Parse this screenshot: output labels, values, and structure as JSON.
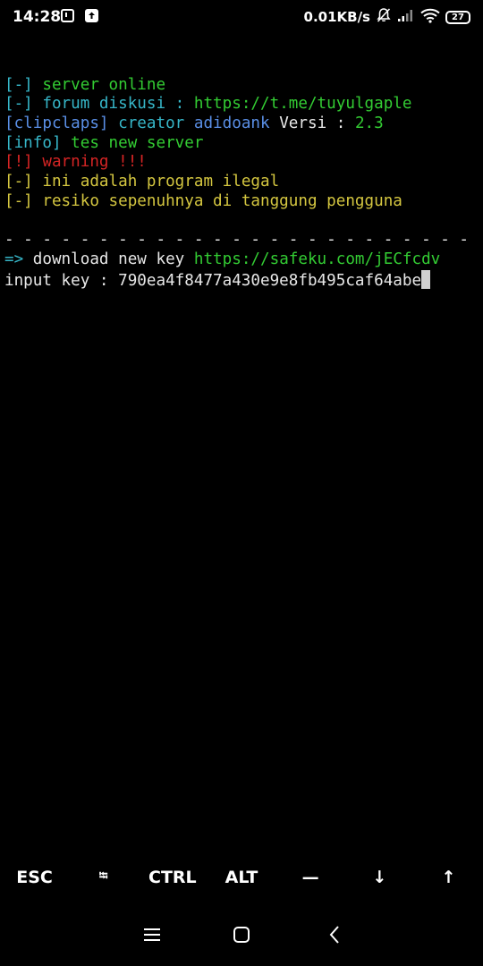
{
  "status_bar": {
    "time": "14:28",
    "net_speed": "0.01KB/s",
    "battery": "27",
    "icons": [
      "notification-icon",
      "upload-icon",
      "silent-bell-icon",
      "signal-icon",
      "wifi-icon",
      "battery-icon"
    ]
  },
  "terminal": {
    "lines": [
      {
        "parts": [
          {
            "text": "",
            "color": "cyan"
          }
        ]
      },
      {
        "parts": [
          {
            "text": "[-] ",
            "color": "cyan"
          },
          {
            "text": "server online",
            "color": "green"
          }
        ]
      },
      {
        "parts": [
          {
            "text": "[-] ",
            "color": "cyan"
          },
          {
            "text": "forum diskusi : ",
            "color": "cyan"
          },
          {
            "text": "https://t.me/tuyulgaple",
            "color": "green"
          }
        ]
      },
      {
        "parts": [
          {
            "text": "[clipclaps] ",
            "color": "blue"
          },
          {
            "text": "creator ",
            "color": "cyan"
          },
          {
            "text": "adidoank ",
            "color": "blue"
          },
          {
            "text": "Versi : ",
            "color": "white"
          },
          {
            "text": "2.3",
            "color": "green"
          }
        ]
      },
      {
        "parts": [
          {
            "text": "[info] ",
            "color": "cyan"
          },
          {
            "text": "tes new server",
            "color": "green"
          }
        ]
      },
      {
        "parts": [
          {
            "text": "[!] ",
            "color": "red"
          },
          {
            "text": "warning !!!",
            "color": "red"
          }
        ]
      },
      {
        "parts": [
          {
            "text": "[-] ",
            "color": "yellow"
          },
          {
            "text": "ini adalah program ilegal",
            "color": "yellow"
          }
        ]
      },
      {
        "parts": [
          {
            "text": "[-] ",
            "color": "yellow"
          },
          {
            "text": "resiko sepenuhnya di tanggung pengguna",
            "color": "yellow"
          }
        ]
      },
      {
        "parts": [
          {
            "text": "",
            "color": "white"
          }
        ]
      },
      {
        "parts": [
          {
            "text": "- - - - - - - - - - - - - - - - - - - - - - - - -",
            "color": "white"
          }
        ]
      },
      {
        "parts": [
          {
            "text": "=> ",
            "color": "cyan"
          },
          {
            "text": "download new key ",
            "color": "white"
          },
          {
            "text": "https://safeku.com/jECfcdv",
            "color": "green"
          }
        ]
      },
      {
        "parts": [
          {
            "text": "input key : ",
            "color": "white"
          },
          {
            "text": "790ea4f8477a430e9e8fb495caf64abe",
            "color": "white"
          }
        ],
        "cursor": true
      }
    ]
  },
  "extra_keys": [
    {
      "label": "ESC",
      "name": "esc-key"
    },
    {
      "label": "⭾",
      "name": "tab-key"
    },
    {
      "label": "CTRL",
      "name": "ctrl-key"
    },
    {
      "label": "ALT",
      "name": "alt-key"
    },
    {
      "label": "—",
      "name": "dash-key"
    },
    {
      "label": "↓",
      "name": "down-arrow-key"
    },
    {
      "label": "↑",
      "name": "up-arrow-key"
    }
  ],
  "colors": {
    "cyan": "#36b6c8",
    "green": "#33cc33",
    "blue": "#5a8fe6",
    "white": "#e8e8e8",
    "red": "#d42424",
    "yellow": "#d4c640",
    "background": "#000000"
  },
  "nav_bar": {
    "buttons": [
      "menu-icon",
      "home-icon",
      "back-icon"
    ]
  }
}
